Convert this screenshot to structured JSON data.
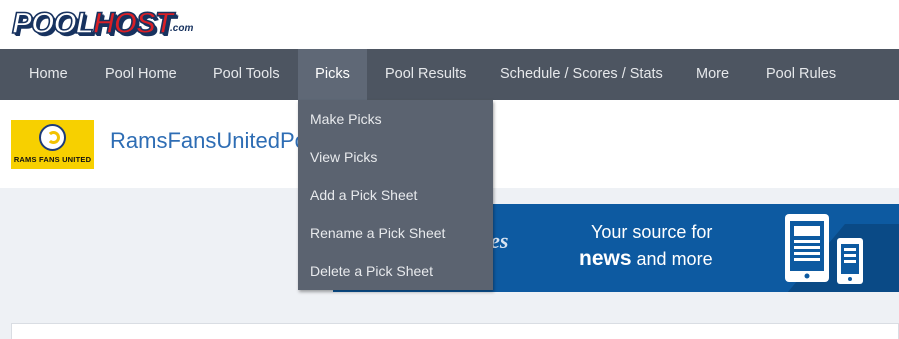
{
  "logo": {
    "pool": "POOL",
    "host": "HOST",
    "com": ".com"
  },
  "nav": {
    "items": [
      {
        "label": "Home"
      },
      {
        "label": "Pool Home"
      },
      {
        "label": "Pool Tools"
      },
      {
        "label": "Picks"
      },
      {
        "label": "Pool Results"
      },
      {
        "label": "Schedule / Scores / Stats"
      },
      {
        "label": "More"
      },
      {
        "label": "Pool Rules"
      }
    ],
    "active": "Picks"
  },
  "dropdown": {
    "items": [
      {
        "label": "Make Picks"
      },
      {
        "label": "View Picks"
      },
      {
        "label": "Add a Pick Sheet"
      },
      {
        "label": "Rename a Pick Sheet"
      },
      {
        "label": "Delete a Pick Sheet"
      }
    ]
  },
  "pool": {
    "logo_text": "RAMS FANS UNITED",
    "title": "RamsFansUnitedPool"
  },
  "ad": {
    "brand_fragment": "mes",
    "line1": "Your source for",
    "line2_strong": "news",
    "line2_rest": " and more"
  },
  "colors": {
    "nav_bg": "#4d5561",
    "dropdown_bg": "#5b6370",
    "link_blue": "#2e6db4",
    "ad_blue": "#0d5aa1",
    "logo_red": "#d91f26"
  }
}
